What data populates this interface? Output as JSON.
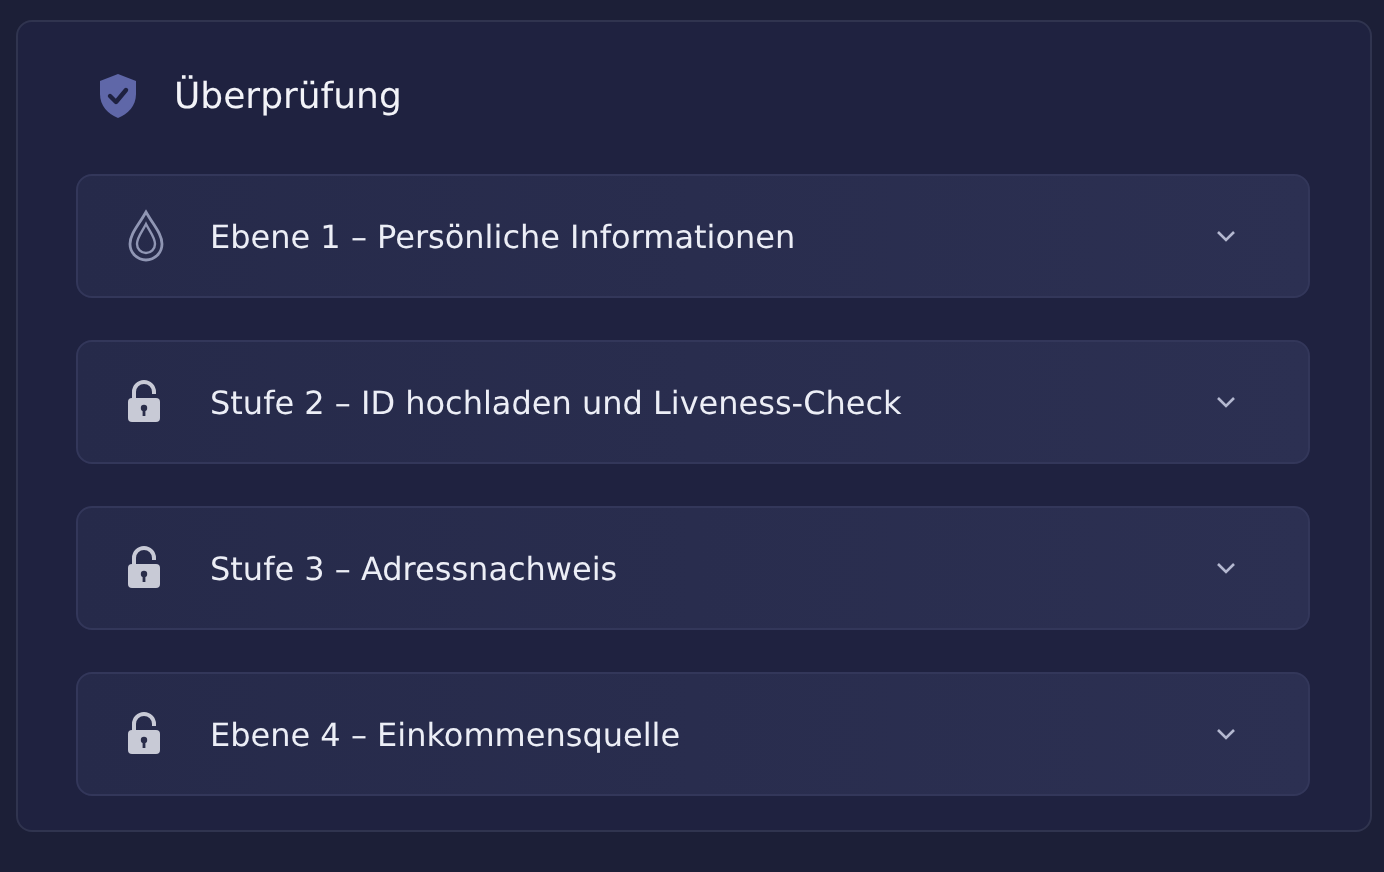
{
  "panel": {
    "title": "Überprüfung"
  },
  "levels": [
    {
      "kind": "current",
      "label": "Ebene 1 – Persönliche Informationen",
      "expanded": false
    },
    {
      "kind": "locked",
      "label": "Stufe 2 – ID hochladen und Liveness-Check",
      "expanded": false
    },
    {
      "kind": "locked",
      "label": "Stufe 3 – Adressnachweis",
      "expanded": false
    },
    {
      "kind": "locked",
      "label": "Ebene 4 – Einkommensquelle",
      "expanded": false
    }
  ]
}
